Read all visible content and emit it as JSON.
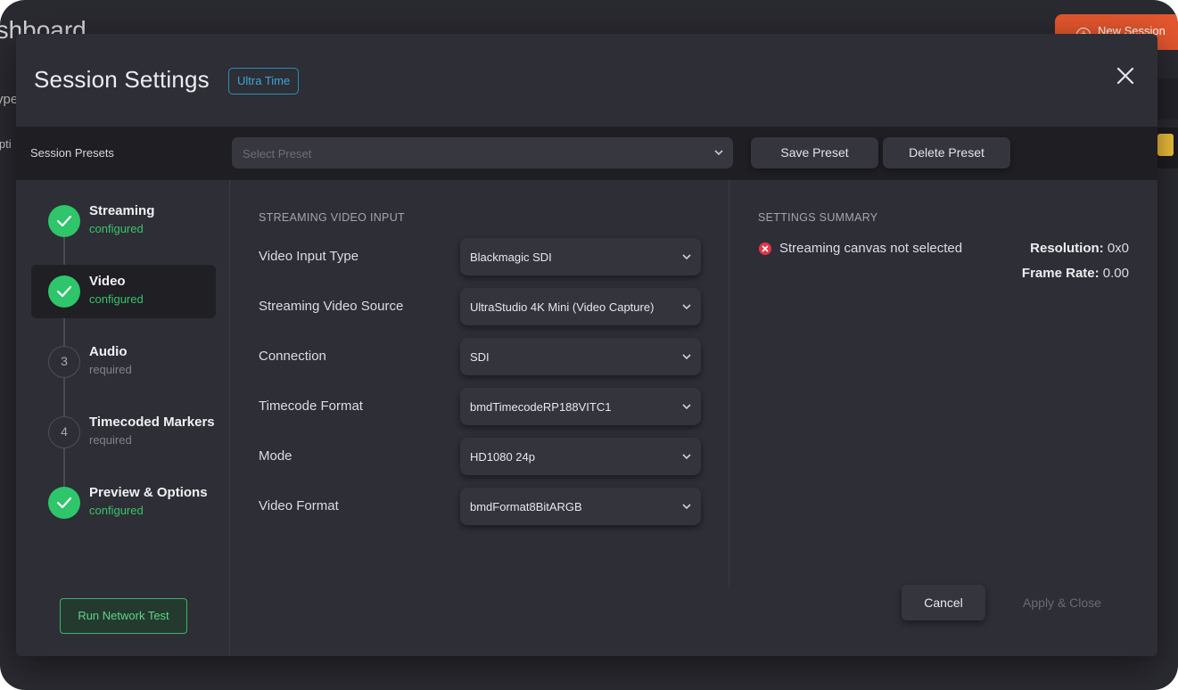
{
  "background": {
    "title": "ashboard",
    "new_session_label": "New Session",
    "type_label": "ype",
    "desc_label": "ipti"
  },
  "modal": {
    "title": "Session Settings",
    "plan_badge": "Ultra Time"
  },
  "presets": {
    "label": "Session Presets",
    "select_placeholder": "Select Preset",
    "save_label": "Save Preset",
    "delete_label": "Delete Preset"
  },
  "steps": [
    {
      "name": "Streaming",
      "status": "configured",
      "state": "done",
      "number": ""
    },
    {
      "name": "Video",
      "status": "configured",
      "state": "done",
      "number": ""
    },
    {
      "name": "Audio",
      "status": "required",
      "state": "todo",
      "number": "3"
    },
    {
      "name": "Timecoded Markers",
      "status": "required",
      "state": "todo",
      "number": "4"
    },
    {
      "name": "Preview & Options",
      "status": "configured",
      "state": "done",
      "number": ""
    }
  ],
  "network_test_label": "Run Network Test",
  "video_input": {
    "section_title": "STREAMING VIDEO INPUT",
    "fields": [
      {
        "label": "Video Input Type",
        "value": "Blackmagic SDI"
      },
      {
        "label": "Streaming Video Source",
        "value": "UltraStudio 4K Mini (Video Capture)"
      },
      {
        "label": "Connection",
        "value": "SDI"
      },
      {
        "label": "Timecode Format",
        "value": "bmdTimecodeRP188VITC1"
      },
      {
        "label": "Mode",
        "value": "HD1080 24p"
      },
      {
        "label": "Video Format",
        "value": "bmdFormat8BitARGB"
      }
    ]
  },
  "summary": {
    "title": "SETTINGS SUMMARY",
    "error_text": "Streaming canvas not selected",
    "resolution_label": "Resolution:",
    "resolution_value": "0x0",
    "frame_rate_label": "Frame Rate:",
    "frame_rate_value": "0.00"
  },
  "footer": {
    "cancel_label": "Cancel",
    "apply_label": "Apply & Close"
  },
  "colors": {
    "accent_green": "#2fc56a",
    "accent_orange": "#e4572e",
    "badge_blue": "#2c8fb8",
    "error_red": "#e0374a"
  }
}
